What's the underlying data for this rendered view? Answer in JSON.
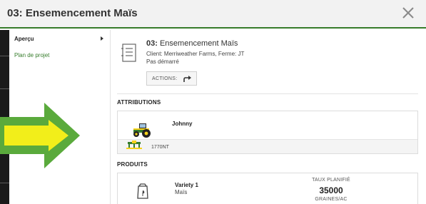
{
  "header": {
    "title": "03: Ensemencement Maïs",
    "close_icon": "close-icon"
  },
  "sidebar": {
    "items": [
      {
        "label": "Aperçu",
        "selected": true,
        "icon": "chevron-right-icon"
      },
      {
        "label": "Plan de projet",
        "selected": false
      }
    ]
  },
  "task": {
    "icon": "document-list-icon",
    "number": "03:",
    "name": "Ensemencement Maïs",
    "client_line": "Client: Merriweather Farms, Ferme: JT",
    "status": "Pas démarré",
    "actions_label": "ACTIONS:",
    "actions_icon": "share-arrow-icon"
  },
  "attributions": {
    "title": "ATTRIBUTIONS",
    "operator": "Johnny",
    "machine_icon": "tractor-icon",
    "implement_icon": "planter-icon",
    "implement": "1770NT"
  },
  "produits": {
    "title": "PRODUITS",
    "icon": "seed-bag-icon",
    "product_name": "Variety 1",
    "crop": "Maïs",
    "rate_label": "TAUX PLANIFIÉ",
    "rate_value": "35000",
    "rate_unit": "GRAINES/AC"
  },
  "colors": {
    "accent_green": "#367c2b",
    "arrow_green": "#5aaa3c",
    "arrow_yellow": "#f2ee1a",
    "tractor_yellow": "#f6d21a"
  }
}
